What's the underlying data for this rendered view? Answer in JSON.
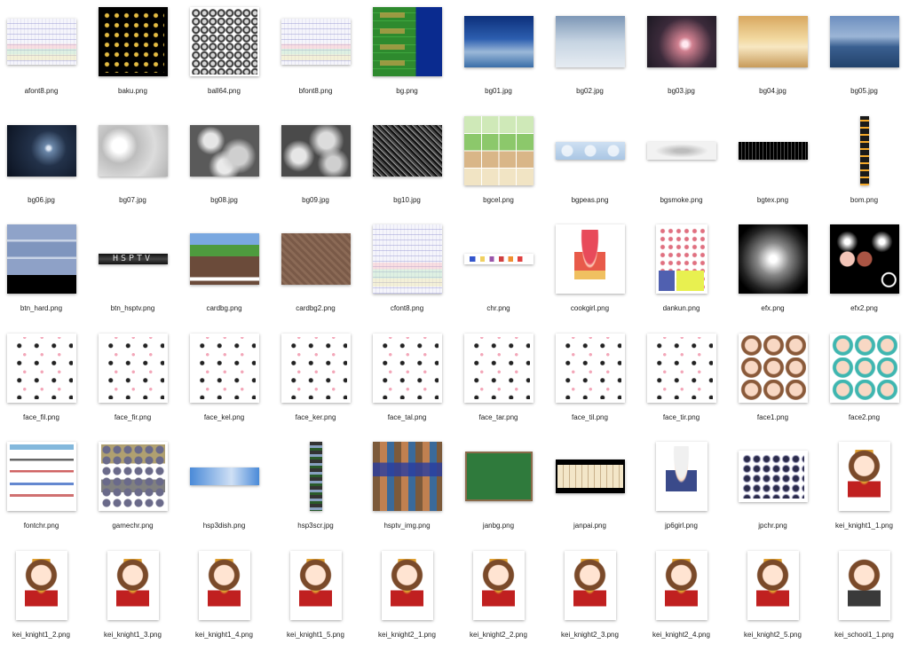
{
  "files": [
    {
      "name": "afont8.png",
      "size": "wide2",
      "look": "text"
    },
    {
      "name": "baku.png",
      "size": "full",
      "look": "baku"
    },
    {
      "name": "ball64.png",
      "size": "full",
      "look": "ball"
    },
    {
      "name": "bfont8.png",
      "size": "wide2",
      "look": "text"
    },
    {
      "name": "bg.png",
      "size": "full",
      "look": "bg"
    },
    {
      "name": "bg01.jpg",
      "size": "wide",
      "look": "sky1"
    },
    {
      "name": "bg02.jpg",
      "size": "wide",
      "look": "sky2"
    },
    {
      "name": "bg03.jpg",
      "size": "wide",
      "look": "sky3"
    },
    {
      "name": "bg04.jpg",
      "size": "wide",
      "look": "sky4"
    },
    {
      "name": "bg05.jpg",
      "size": "wide",
      "look": "sky5"
    },
    {
      "name": "bg06.jpg",
      "size": "wide",
      "look": "night"
    },
    {
      "name": "bg07.jpg",
      "size": "wide",
      "look": "cloud1"
    },
    {
      "name": "bg08.jpg",
      "size": "wide",
      "look": "cloud2"
    },
    {
      "name": "bg09.jpg",
      "size": "wide",
      "look": "cloud3"
    },
    {
      "name": "bg10.jpg",
      "size": "wide",
      "look": "noise"
    },
    {
      "name": "bgcel.png",
      "size": "full",
      "look": "tiles"
    },
    {
      "name": "bgpeas.png",
      "size": "strip",
      "look": "peas"
    },
    {
      "name": "bgsmoke.png",
      "size": "strip",
      "look": "smoke"
    },
    {
      "name": "bgtex.png",
      "size": "strip",
      "look": "tex"
    },
    {
      "name": "bom.png",
      "size": "tall",
      "look": "bom"
    },
    {
      "name": "btn_hard.png",
      "size": "full",
      "look": "hard"
    },
    {
      "name": "btn_hsptv.png",
      "size": "thin",
      "look": "hsptv"
    },
    {
      "name": "cardbg.png",
      "size": "wide",
      "look": "card"
    },
    {
      "name": "cardbg2.png",
      "size": "wide",
      "look": "card2"
    },
    {
      "name": "cfont8.png",
      "size": "full",
      "look": "text"
    },
    {
      "name": "chr.png",
      "size": "thin",
      "look": "chr"
    },
    {
      "name": "cookgirl.png",
      "size": "full",
      "look": "girl"
    },
    {
      "name": "dankun.png",
      "size": "portrait",
      "look": "dankun"
    },
    {
      "name": "efx.png",
      "size": "full",
      "look": "efx"
    },
    {
      "name": "efx2.png",
      "size": "full",
      "look": "efx2"
    },
    {
      "name": "face_fil.png",
      "size": "full",
      "look": "face"
    },
    {
      "name": "face_fir.png",
      "size": "full",
      "look": "face"
    },
    {
      "name": "face_kel.png",
      "size": "full",
      "look": "face"
    },
    {
      "name": "face_ker.png",
      "size": "full",
      "look": "face"
    },
    {
      "name": "face_tal.png",
      "size": "full",
      "look": "face"
    },
    {
      "name": "face_tar.png",
      "size": "full",
      "look": "face"
    },
    {
      "name": "face_til.png",
      "size": "full",
      "look": "face"
    },
    {
      "name": "face_tir.png",
      "size": "full",
      "look": "face"
    },
    {
      "name": "face1.png",
      "size": "full",
      "look": "faces1"
    },
    {
      "name": "face2.png",
      "size": "full",
      "look": "faces2"
    },
    {
      "name": "fontchr.png",
      "size": "full",
      "look": "fontchr"
    },
    {
      "name": "gamechr.png",
      "size": "full",
      "look": "game"
    },
    {
      "name": "hsp3dish.png",
      "size": "strip",
      "look": "dish"
    },
    {
      "name": "hsp3scr.jpg",
      "size": "tall2",
      "look": "scr"
    },
    {
      "name": "hsptv_img.png",
      "size": "full",
      "look": "hsptvimg"
    },
    {
      "name": "janbg.png",
      "size": "janbg",
      "look": "janbg"
    },
    {
      "name": "janpai.png",
      "size": "small-w",
      "look": "janpai"
    },
    {
      "name": "jp6girl.png",
      "size": "portrait",
      "look": "jpgirl"
    },
    {
      "name": "jpchr.png",
      "size": "wide",
      "look": "jpchr"
    },
    {
      "name": "kei_knight1_1.png",
      "size": "portrait",
      "look": "kei"
    },
    {
      "name": "kei_knight1_2.png",
      "size": "portrait",
      "look": "kei"
    },
    {
      "name": "kei_knight1_3.png",
      "size": "portrait",
      "look": "kei"
    },
    {
      "name": "kei_knight1_4.png",
      "size": "portrait",
      "look": "kei"
    },
    {
      "name": "kei_knight1_5.png",
      "size": "portrait",
      "look": "kei"
    },
    {
      "name": "kei_knight2_1.png",
      "size": "portrait",
      "look": "kei"
    },
    {
      "name": "kei_knight2_2.png",
      "size": "portrait",
      "look": "kei"
    },
    {
      "name": "kei_knight2_3.png",
      "size": "portrait",
      "look": "kei"
    },
    {
      "name": "kei_knight2_4.png",
      "size": "portrait",
      "look": "kei"
    },
    {
      "name": "kei_knight2_5.png",
      "size": "portrait",
      "look": "kei"
    },
    {
      "name": "kei_school1_1.png",
      "size": "portrait",
      "look": "kei-school"
    }
  ]
}
